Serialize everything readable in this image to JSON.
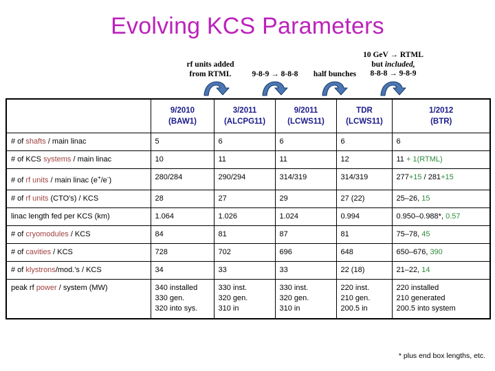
{
  "title": "Evolving KCS Parameters",
  "theme": {
    "title_color": "#BB22BB",
    "header_text_color": "#1A1A8C",
    "keyword_color": "#A04040",
    "highlight_green": "#2E8B3C",
    "arrow_color": "#4A77B5"
  },
  "annotations": [
    {
      "id": "ann1",
      "line1": "rf units added",
      "line2": "from RTML",
      "line3": ""
    },
    {
      "id": "ann2",
      "line1": "",
      "line2": "9-8-9 → 8-8-8",
      "line3": ""
    },
    {
      "id": "ann3",
      "line1": "",
      "line2": "half bunches",
      "line3": ""
    },
    {
      "id": "ann4",
      "line1": "10 GeV → RTML",
      "line2_pre": "but ",
      "line2_ital": "included,",
      "line3": "8-8-8 → 9-8-9"
    }
  ],
  "arrow_icon_name": "curved-arrow-icon",
  "table": {
    "headers": [
      {
        "line1": "",
        "line2": ""
      },
      {
        "line1": "9/2010",
        "line2": "(BAW1)"
      },
      {
        "line1": "3/2011",
        "line2": "(ALCPG11)"
      },
      {
        "line1": "9/2011",
        "line2": "(LCWS11)"
      },
      {
        "line1": "TDR",
        "line2": "(LCWS11)"
      },
      {
        "line1": "1/2012",
        "line2": "(BTR)"
      }
    ],
    "rows": [
      {
        "label_pre": "# of ",
        "label_kw": "shafts",
        "label_post": " / main linac",
        "c1": [
          "5"
        ],
        "c2": [
          "6"
        ],
        "c3": [
          "6"
        ],
        "c4": [
          "6"
        ],
        "c5_plain": "6",
        "c5_green": ""
      },
      {
        "label_pre": "# of KCS ",
        "label_kw": "systems",
        "label_post": " / main linac",
        "c1": [
          "10"
        ],
        "c2": [
          "11"
        ],
        "c3": [
          "11"
        ],
        "c4": [
          "12"
        ],
        "c5_plain": "11 ",
        "c5_green": "+ 1(RTML)"
      },
      {
        "label_pre": "# of ",
        "label_kw": "rf units",
        "label_post": " / main linac (e+/e-)",
        "c1": [
          "280/284"
        ],
        "c2": [
          "290/294"
        ],
        "c3": [
          "314/319"
        ],
        "c4": [
          "314/319"
        ],
        "c5_plain": "277",
        "c5_green": "+15",
        "c5_plain2": " / 281",
        "c5_green2": "+15"
      },
      {
        "label_pre": "# of ",
        "label_kw": "rf units",
        "label_post": " (CTO's) / KCS",
        "c1": [
          "28"
        ],
        "c2": [
          "27"
        ],
        "c3": [
          "29"
        ],
        "c4": [
          "27 (22)"
        ],
        "c5_plain": "25–26,  ",
        "c5_green": "15"
      },
      {
        "label_pre": "linac length fed per KCS (km)",
        "label_kw": "",
        "label_post": "",
        "c1": [
          "1.064"
        ],
        "c2": [
          "1.026"
        ],
        "c3": [
          "1.024"
        ],
        "c4": [
          "0.994"
        ],
        "c5_plain": "0.950–0.988*,  ",
        "c5_green": "0.57"
      },
      {
        "label_pre": "# of ",
        "label_kw": "cryomodules",
        "label_post": " / KCS",
        "c1": [
          "84"
        ],
        "c2": [
          "81"
        ],
        "c3": [
          "87"
        ],
        "c4": [
          "81"
        ],
        "c5_plain": "75–78,  ",
        "c5_green": "45"
      },
      {
        "label_pre": "# of ",
        "label_kw": "cavities",
        "label_post": " / KCS",
        "c1": [
          "728"
        ],
        "c2": [
          "702"
        ],
        "c3": [
          "696"
        ],
        "c4": [
          "648"
        ],
        "c5_plain": "650–676,  ",
        "c5_green": "390"
      },
      {
        "label_pre": "# of ",
        "label_kw": "klystrons",
        "label_post": "/mod.'s / KCS",
        "c1": [
          "34"
        ],
        "c2": [
          "33"
        ],
        "c3": [
          "33"
        ],
        "c4": [
          "22 (18)"
        ],
        "c5_plain": "21–22,  ",
        "c5_green": "14"
      },
      {
        "label_pre": "peak rf ",
        "label_kw": "power",
        "label_post": " / system (MW)",
        "c1": [
          "340 installed",
          "330 gen.",
          "320 into sys."
        ],
        "c2": [
          "330 inst.",
          "320 gen.",
          "310 in"
        ],
        "c3": [
          "330 inst.",
          "320 gen.",
          "310 in"
        ],
        "c4": [
          "220 inst.",
          "210 gen.",
          "200.5 in"
        ],
        "c5_lines": [
          "220 installed",
          "210 generated",
          "200.5 into system"
        ]
      }
    ]
  },
  "footnote": "* plus end box lengths, etc."
}
